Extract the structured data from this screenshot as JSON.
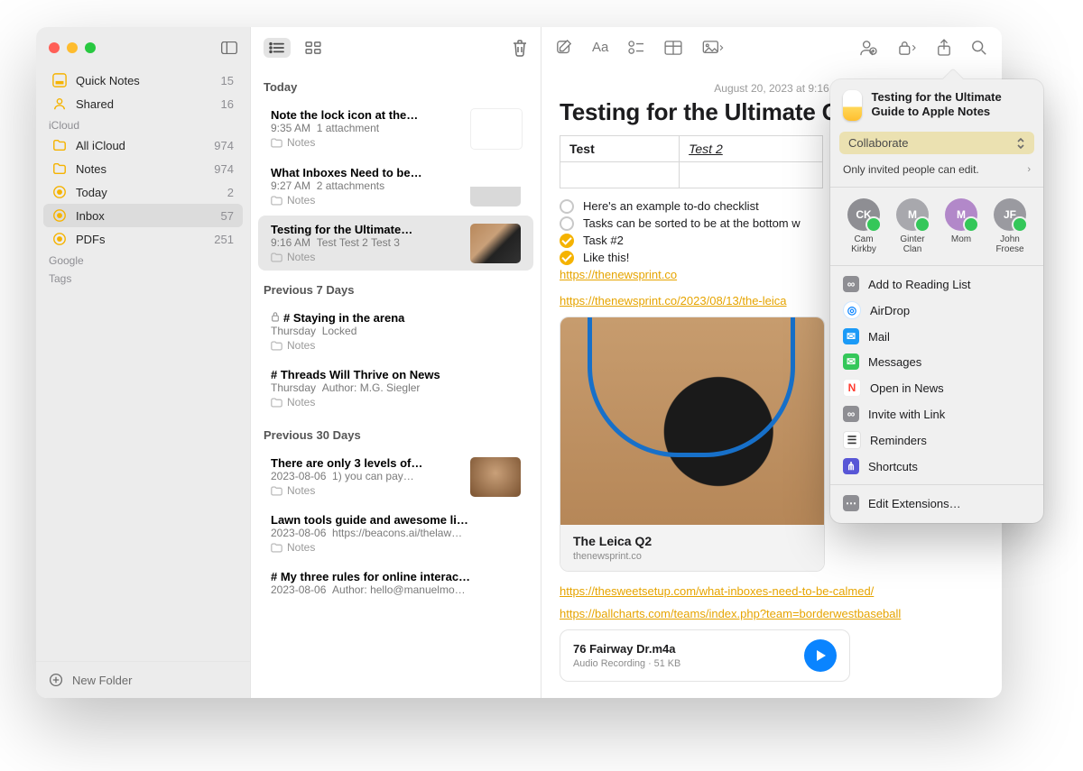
{
  "sidebar": {
    "pinned": [
      {
        "icon": "quicknotes",
        "label": "Quick Notes",
        "count": 15
      },
      {
        "icon": "shared",
        "label": "Shared",
        "count": 16
      }
    ],
    "sections": [
      {
        "header": "iCloud",
        "items": [
          {
            "icon": "folder",
            "label": "All iCloud",
            "count": 974
          },
          {
            "icon": "folder",
            "label": "Notes",
            "count": 974
          },
          {
            "icon": "smart",
            "label": "Today",
            "count": 2
          },
          {
            "icon": "smart",
            "label": "Inbox",
            "count": 57,
            "selected": true
          },
          {
            "icon": "smart",
            "label": "PDFs",
            "count": 251
          }
        ]
      },
      {
        "header": "Google",
        "items": []
      },
      {
        "header": "Tags",
        "items": []
      }
    ],
    "footer": {
      "label": "New Folder"
    }
  },
  "list": {
    "groups": [
      {
        "header": "Today",
        "rows": [
          {
            "title": "Note the lock icon at the…",
            "time": "9:35 AM",
            "meta": "1 attachment",
            "folder": "Notes",
            "thumb": "paper"
          },
          {
            "title": "What Inboxes Need to be…",
            "time": "9:27 AM",
            "meta": "2 attachments",
            "folder": "Notes",
            "thumb": "desk"
          },
          {
            "title": "Testing for the Ultimate…",
            "time": "9:16 AM",
            "meta": "Test Test 2 Test 3",
            "folder": "Notes",
            "thumb": "camera",
            "selected": true
          }
        ]
      },
      {
        "header": "Previous 7 Days",
        "rows": [
          {
            "title": "# Staying in the arena",
            "time": "Thursday",
            "meta": "Locked",
            "folder": "Notes",
            "locked": true
          },
          {
            "title": "# Threads Will Thrive on News",
            "time": "Thursday",
            "meta": "Author: M.G. Siegler",
            "folder": "Notes"
          }
        ]
      },
      {
        "header": "Previous 30 Days",
        "rows": [
          {
            "title": "There are only 3 levels of…",
            "time": "2023-08-06",
            "meta": "1) you can pay…",
            "folder": "Notes",
            "thumb": "face"
          },
          {
            "title": "Lawn tools guide and awesome li…",
            "time": "2023-08-06",
            "meta": "https://beacons.ai/thelaw…",
            "folder": "Notes"
          },
          {
            "title": "# My three rules for online interac…",
            "time": "2023-08-06",
            "meta": "Author: hello@manuelmo…"
          }
        ]
      }
    ]
  },
  "editor": {
    "date": "August 20, 2023 at 9:16",
    "title": "Testing for the Ultimate Guide",
    "table": {
      "h1": "Test",
      "h2": "Test 2"
    },
    "checks": [
      {
        "done": false,
        "text": "Here's an example to-do checklist"
      },
      {
        "done": false,
        "text": "Tasks can be sorted to be at the bottom w"
      },
      {
        "done": true,
        "text": "Task #2"
      },
      {
        "done": true,
        "text": "Like this!"
      }
    ],
    "links": {
      "a": "https://thenewsprint.co",
      "b": "https://thenewsprint.co/2023/08/13/the-leica",
      "c": "https://thesweetsetup.com/what-inboxes-need-to-be-calmed/",
      "d": "https://ballcharts.com/teams/index.php?team=borderwestbaseball"
    },
    "card": {
      "title": "The Leica Q2",
      "sub": "thenewsprint.co"
    },
    "audio": {
      "title": "76 Fairway Dr.m4a",
      "sub": "Audio Recording · 51 KB"
    }
  },
  "share": {
    "title": "Testing for the Ultimate Guide to Apple Notes",
    "mode": "Collaborate",
    "subtitle": "Only invited people can edit.",
    "people": [
      {
        "initials": "CK",
        "name": "Cam Kirkby",
        "color": "#8e8e93"
      },
      {
        "initials": "M",
        "name": "Ginter Clan",
        "color": "#a8a8ad",
        "group": true
      },
      {
        "initials": "M",
        "name": "Mom",
        "color": "#b288c9"
      },
      {
        "initials": "JF",
        "name": "John Froese",
        "color": "#9a9aa0"
      }
    ],
    "menu": [
      {
        "icon": "readlist",
        "label": "Add to Reading List"
      },
      {
        "icon": "airdrop",
        "label": "AirDrop"
      },
      {
        "icon": "mail",
        "label": "Mail"
      },
      {
        "icon": "msg",
        "label": "Messages"
      },
      {
        "icon": "news",
        "label": "Open in News"
      },
      {
        "icon": "link",
        "label": "Invite with Link"
      },
      {
        "icon": "rem",
        "label": "Reminders"
      },
      {
        "icon": "short",
        "label": "Shortcuts"
      }
    ],
    "edit": "Edit Extensions…"
  }
}
